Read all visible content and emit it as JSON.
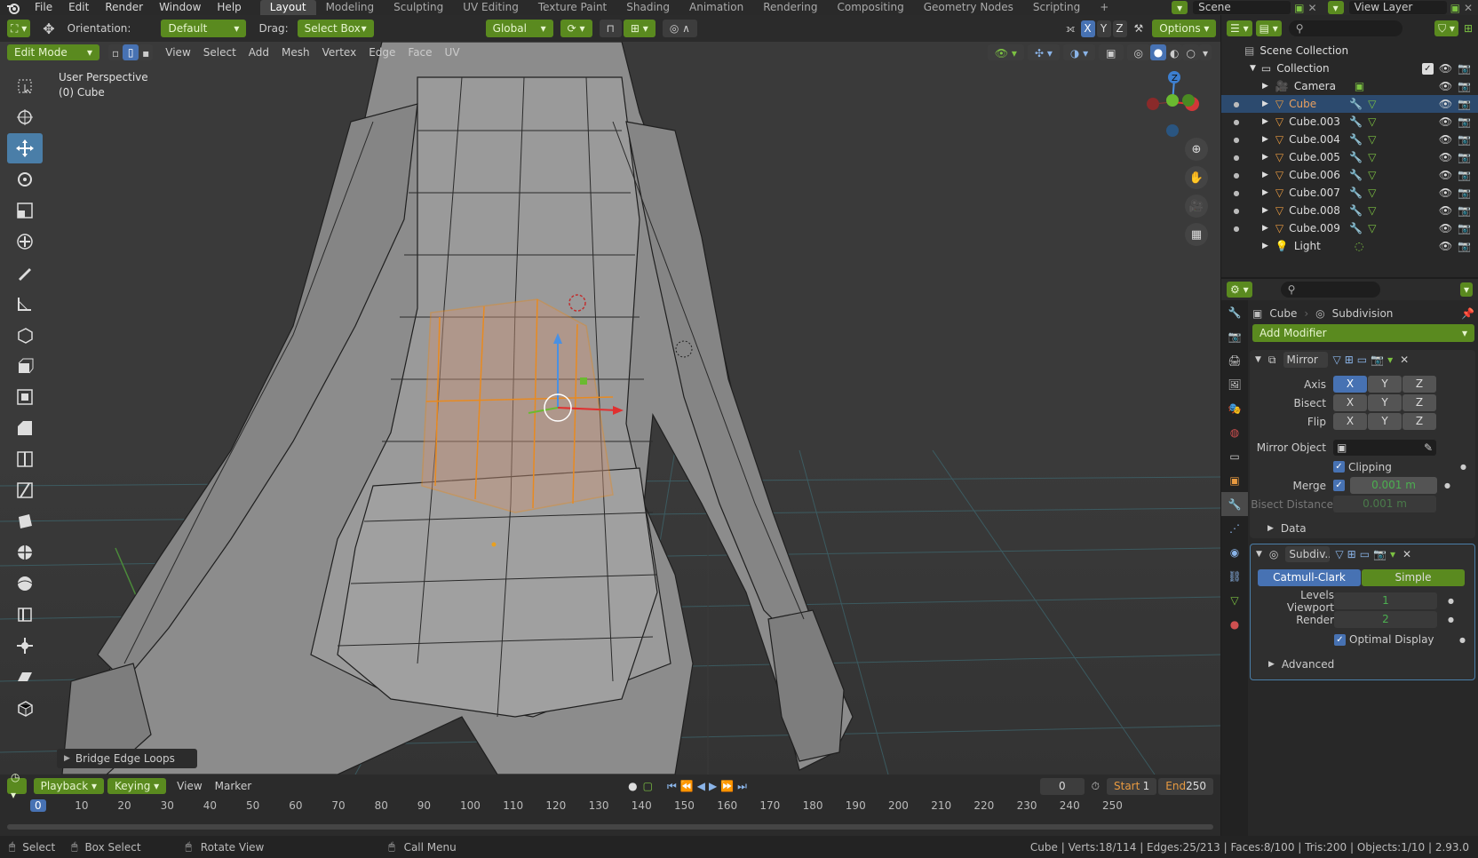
{
  "menubar": {
    "menus": [
      "File",
      "Edit",
      "Render",
      "Window",
      "Help"
    ],
    "workspaces": [
      "Layout",
      "Modeling",
      "Sculpting",
      "UV Editing",
      "Texture Paint",
      "Shading",
      "Animation",
      "Rendering",
      "Compositing",
      "Geometry Nodes",
      "Scripting"
    ],
    "active_workspace": "Layout",
    "add_label": "+",
    "scene": "Scene",
    "view_layer": "View Layer"
  },
  "header": {
    "orientation_label": "Orientation:",
    "orientation_value": "Default",
    "drag_label": "Drag:",
    "drag_value": "Select Box",
    "transform_value": "Global",
    "mode": "Edit Mode",
    "menus": [
      "View",
      "Select",
      "Add",
      "Mesh",
      "Vertex",
      "Edge",
      "Face",
      "UV"
    ],
    "axes": [
      "X",
      "Y",
      "Z"
    ],
    "options": "Options"
  },
  "viewport": {
    "perspective": "User Perspective",
    "object": "(0) Cube",
    "last_op": "Bridge Edge Loops"
  },
  "gizmo": {
    "x": "X",
    "y": "Y",
    "z": "Z"
  },
  "outliner": {
    "root": "Scene Collection",
    "collection": "Collection",
    "items": [
      {
        "name": "Camera",
        "type": "camera"
      },
      {
        "name": "Cube",
        "type": "mesh",
        "selected": true
      },
      {
        "name": "Cube.003",
        "type": "mesh"
      },
      {
        "name": "Cube.004",
        "type": "mesh"
      },
      {
        "name": "Cube.005",
        "type": "mesh"
      },
      {
        "name": "Cube.006",
        "type": "mesh"
      },
      {
        "name": "Cube.007",
        "type": "mesh"
      },
      {
        "name": "Cube.008",
        "type": "mesh"
      },
      {
        "name": "Cube.009",
        "type": "mesh"
      },
      {
        "name": "Light",
        "type": "light"
      }
    ]
  },
  "properties": {
    "object": "Cube",
    "modifier_ctx": "Subdivision",
    "add_modifier": "Add Modifier",
    "mirror": {
      "name": "Mirror",
      "axis_label": "Axis",
      "bisect_label": "Bisect",
      "flip_label": "Flip",
      "axes": [
        "X",
        "Y",
        "Z"
      ],
      "mirror_object_label": "Mirror Object",
      "clipping_label": "Clipping",
      "merge_label": "Merge",
      "merge_value": "0.001 m",
      "bisect_distance_label": "Bisect Distance",
      "bisect_distance_value": "0.001 m",
      "data_label": "Data"
    },
    "subdiv": {
      "name": "Subdiv...",
      "catmull": "Catmull-Clark",
      "simple": "Simple",
      "levels_label": "Levels Viewport",
      "levels_value": "1",
      "render_label": "Render",
      "render_value": "2",
      "optimal_label": "Optimal Display",
      "advanced_label": "Advanced"
    }
  },
  "timeline": {
    "menus": [
      "Playback",
      "Keying",
      "View",
      "Marker"
    ],
    "current_frame": "0",
    "start_label": "Start",
    "start_value": "1",
    "end_label": "End",
    "end_value": "250",
    "ticks": [
      "0",
      "10",
      "20",
      "30",
      "40",
      "50",
      "60",
      "70",
      "80",
      "90",
      "100",
      "110",
      "120",
      "130",
      "140",
      "150",
      "160",
      "170",
      "180",
      "190",
      "200",
      "210",
      "220",
      "230",
      "240",
      "250"
    ]
  },
  "status": {
    "select": "Select",
    "box_select": "Box Select",
    "rotate": "Rotate View",
    "call_menu": "Call Menu",
    "stats": "Cube | Verts:18/114 | Edges:25/213 | Faces:8/100 | Tris:200 | Objects:1/10 | 2.93.0"
  }
}
